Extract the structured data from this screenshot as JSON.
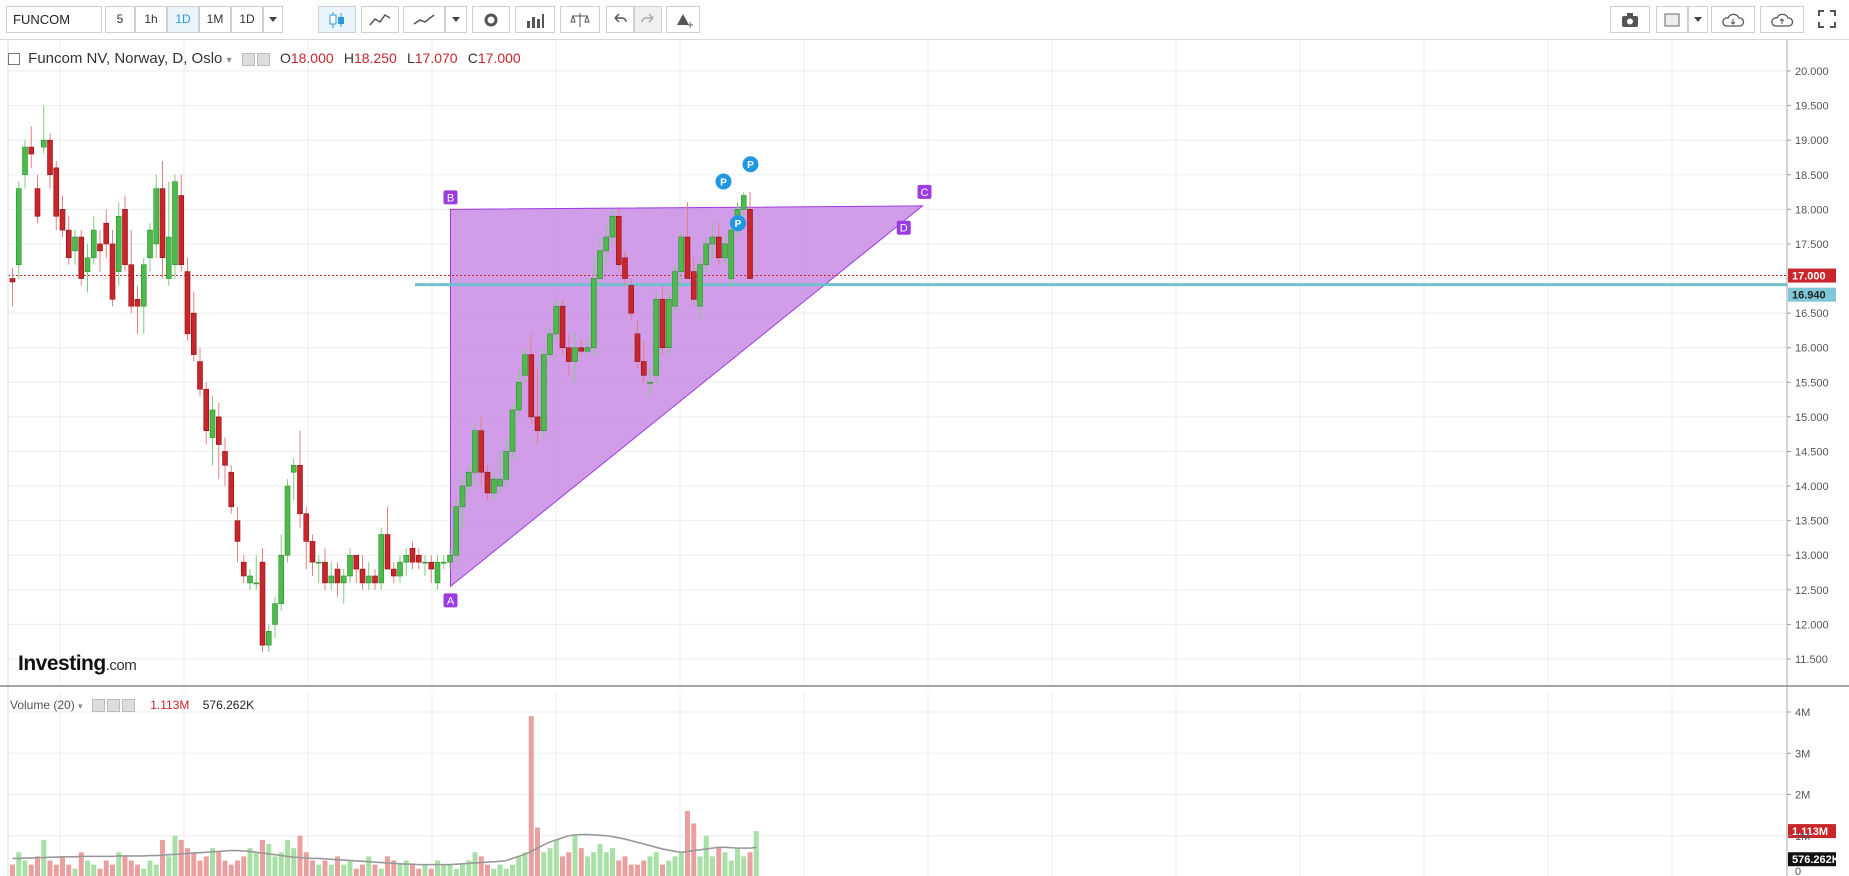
{
  "toolbar": {
    "symbol": "FUNCOM",
    "intervals": [
      "5",
      "1h",
      "1D",
      "1M",
      "1D"
    ],
    "active_interval": "1D"
  },
  "legend": {
    "title": "Funcom NV, Norway, D, Oslo",
    "o_label": "O",
    "o_value": "18.000",
    "h_label": "H",
    "h_value": "18.250",
    "l_label": "L",
    "l_value": "17.070",
    "c_label": "C",
    "c_value": "17.000"
  },
  "volume_legend": {
    "title": "Volume (20)",
    "value": "1.113M",
    "ma_value": "576.262K"
  },
  "watermark": {
    "brand": "Investing",
    "suffix": ".com"
  },
  "colors": {
    "up": "#4cbb4c",
    "down": "#c8262a",
    "pattern": "#9b3ce0",
    "pattern_fill": "#c98be4",
    "hline": "#6fbfd0"
  },
  "chart_data": [
    {
      "type": "candlestick",
      "title": "Funcom NV, Norway, D, Oslo",
      "y_ticks": [
        "11.500",
        "12.000",
        "12.500",
        "13.000",
        "13.500",
        "14.000",
        "14.500",
        "15.000",
        "15.500",
        "16.000",
        "16.500",
        "17.000",
        "17.500",
        "18.000",
        "18.500",
        "19.000",
        "19.500",
        "20.000"
      ],
      "ylim": [
        11.2,
        20.3
      ],
      "grid": true,
      "ohlc": [
        [
          17.0,
          17.15,
          16.6,
          16.95
        ],
        [
          17.2,
          18.4,
          17.0,
          18.3
        ],
        [
          18.5,
          19.0,
          18.3,
          18.9
        ],
        [
          18.9,
          19.2,
          18.6,
          18.8
        ],
        [
          18.3,
          18.5,
          17.8,
          17.9
        ],
        [
          18.9,
          19.5,
          18.8,
          19.0
        ],
        [
          19.0,
          19.1,
          18.3,
          18.5
        ],
        [
          18.6,
          18.7,
          17.7,
          17.9
        ],
        [
          18.0,
          18.2,
          17.6,
          17.7
        ],
        [
          17.7,
          17.9,
          17.2,
          17.3
        ],
        [
          17.4,
          17.7,
          17.2,
          17.6
        ],
        [
          17.6,
          17.7,
          16.9,
          17.0
        ],
        [
          17.1,
          17.5,
          16.8,
          17.3
        ],
        [
          17.3,
          17.9,
          17.2,
          17.7
        ],
        [
          17.5,
          17.7,
          17.1,
          17.4
        ],
        [
          17.8,
          18.0,
          17.3,
          17.5
        ],
        [
          17.5,
          17.7,
          16.6,
          16.7
        ],
        [
          17.1,
          18.1,
          16.9,
          17.9
        ],
        [
          18.0,
          18.2,
          17.1,
          17.2
        ],
        [
          17.2,
          17.7,
          16.5,
          16.6
        ],
        [
          16.7,
          16.9,
          16.2,
          16.6
        ],
        [
          16.6,
          17.3,
          16.2,
          17.2
        ],
        [
          17.3,
          17.8,
          17.1,
          17.7
        ],
        [
          17.5,
          18.5,
          17.3,
          18.3
        ],
        [
          18.3,
          18.7,
          17.0,
          17.3
        ],
        [
          17.0,
          18.4,
          16.9,
          17.6
        ],
        [
          17.2,
          18.5,
          17.0,
          18.4
        ],
        [
          18.2,
          18.5,
          17.1,
          17.2
        ],
        [
          17.1,
          17.3,
          16.1,
          16.2
        ],
        [
          16.5,
          16.8,
          15.8,
          15.9
        ],
        [
          15.8,
          16.0,
          15.3,
          15.4
        ],
        [
          15.4,
          15.5,
          14.6,
          14.8
        ],
        [
          14.7,
          15.3,
          14.3,
          15.1
        ],
        [
          15.0,
          15.2,
          14.1,
          14.6
        ],
        [
          14.5,
          14.7,
          14.0,
          14.3
        ],
        [
          14.2,
          14.3,
          13.6,
          13.7
        ],
        [
          13.5,
          13.7,
          12.9,
          13.2
        ],
        [
          12.9,
          13.0,
          12.6,
          12.7
        ],
        [
          12.6,
          12.8,
          12.5,
          12.7
        ],
        [
          12.6,
          13.0,
          12.5,
          12.6
        ],
        [
          12.9,
          13.1,
          11.6,
          11.7
        ],
        [
          11.7,
          12.0,
          11.6,
          11.9
        ],
        [
          12.0,
          12.4,
          11.8,
          12.3
        ],
        [
          12.3,
          13.3,
          12.2,
          13.0
        ],
        [
          13.0,
          14.1,
          12.9,
          14.0
        ],
        [
          14.2,
          14.4,
          13.8,
          14.3
        ],
        [
          14.3,
          14.8,
          13.4,
          13.6
        ],
        [
          13.6,
          13.7,
          12.8,
          13.2
        ],
        [
          13.2,
          13.3,
          12.7,
          12.9
        ],
        [
          12.9,
          13.0,
          12.6,
          12.9
        ],
        [
          12.9,
          13.1,
          12.5,
          12.6
        ],
        [
          12.6,
          12.9,
          12.5,
          12.7
        ],
        [
          12.8,
          12.9,
          12.4,
          12.6
        ],
        [
          12.6,
          12.8,
          12.3,
          12.7
        ],
        [
          12.7,
          13.1,
          12.6,
          13.0
        ],
        [
          13.0,
          13.0,
          12.6,
          12.8
        ],
        [
          12.8,
          13.0,
          12.5,
          12.6
        ],
        [
          12.6,
          12.9,
          12.5,
          12.7
        ],
        [
          12.7,
          12.8,
          12.5,
          12.6
        ],
        [
          12.6,
          13.4,
          12.5,
          13.3
        ],
        [
          13.3,
          13.7,
          12.8,
          12.8
        ],
        [
          12.8,
          12.9,
          12.6,
          12.7
        ],
        [
          12.7,
          13.0,
          12.6,
          12.9
        ],
        [
          12.9,
          13.1,
          12.7,
          13.0
        ],
        [
          13.1,
          13.2,
          12.8,
          12.9
        ],
        [
          13.0,
          13.1,
          12.8,
          12.9
        ],
        [
          12.9,
          13.0,
          12.7,
          12.9
        ],
        [
          12.9,
          13.0,
          12.6,
          12.8
        ],
        [
          12.6,
          13.0,
          12.5,
          12.9
        ],
        [
          12.9,
          13.0,
          12.8,
          12.9
        ],
        [
          12.9,
          13.1,
          12.8,
          13.0
        ],
        [
          13.0,
          13.8,
          12.9,
          13.7
        ],
        [
          13.7,
          14.1,
          13.4,
          14.0
        ],
        [
          14.0,
          14.3,
          13.9,
          14.2
        ],
        [
          14.2,
          14.9,
          14.0,
          14.8
        ],
        [
          14.8,
          15.0,
          14.0,
          14.2
        ],
        [
          14.2,
          14.3,
          13.8,
          13.9
        ],
        [
          13.9,
          14.2,
          13.8,
          14.1
        ],
        [
          14.0,
          14.5,
          13.9,
          14.1
        ],
        [
          14.1,
          14.7,
          14.0,
          14.5
        ],
        [
          14.5,
          15.2,
          14.4,
          15.1
        ],
        [
          15.1,
          15.7,
          15.0,
          15.5
        ],
        [
          15.6,
          16.0,
          15.5,
          15.9
        ],
        [
          15.9,
          16.2,
          14.9,
          15.0
        ],
        [
          15.0,
          15.7,
          14.6,
          14.8
        ],
        [
          14.8,
          16.0,
          14.7,
          15.9
        ],
        [
          15.9,
          16.3,
          15.8,
          16.2
        ],
        [
          16.2,
          16.7,
          16.1,
          16.6
        ],
        [
          16.6,
          16.7,
          15.9,
          16.0
        ],
        [
          16.0,
          16.2,
          15.6,
          15.8
        ],
        [
          15.8,
          16.2,
          15.5,
          16.0
        ],
        [
          16.0,
          16.1,
          15.9,
          15.95
        ],
        [
          15.95,
          16.1,
          15.9,
          16.0
        ],
        [
          16.0,
          17.3,
          15.9,
          17.0
        ],
        [
          17.0,
          17.6,
          16.9,
          17.4
        ],
        [
          17.4,
          17.8,
          17.2,
          17.6
        ],
        [
          17.6,
          18.0,
          17.5,
          17.9
        ],
        [
          17.9,
          18.0,
          17.1,
          17.2
        ],
        [
          17.3,
          17.4,
          16.9,
          17.0
        ],
        [
          16.9,
          17.0,
          16.4,
          16.5
        ],
        [
          16.2,
          16.4,
          15.7,
          15.8
        ],
        [
          15.8,
          16.1,
          15.5,
          15.6
        ],
        [
          15.5,
          15.7,
          15.3,
          15.5
        ],
        [
          15.6,
          16.8,
          15.5,
          16.7
        ],
        [
          16.7,
          16.9,
          15.9,
          16.0
        ],
        [
          16.0,
          16.8,
          15.9,
          16.7
        ],
        [
          16.6,
          17.2,
          16.5,
          17.1
        ],
        [
          17.1,
          17.7,
          16.9,
          17.6
        ],
        [
          17.6,
          18.1,
          17.5,
          17.0
        ],
        [
          17.1,
          17.3,
          16.6,
          16.7
        ],
        [
          16.6,
          17.3,
          16.4,
          17.2
        ],
        [
          17.2,
          17.6,
          17.1,
          17.5
        ],
        [
          17.5,
          17.8,
          17.3,
          17.6
        ],
        [
          17.6,
          17.8,
          17.2,
          17.3
        ],
        [
          17.3,
          17.6,
          17.2,
          17.5
        ],
        [
          17.0,
          17.8,
          16.9,
          17.7
        ],
        [
          17.7,
          18.1,
          17.6,
          18.0
        ],
        [
          18.0,
          18.25,
          17.8,
          18.2
        ],
        [
          18.0,
          18.25,
          17.07,
          17.0
        ]
      ],
      "last_price": "17.000",
      "level_price": "16.940",
      "pattern": {
        "type": "triangle",
        "points": [
          {
            "label": "A",
            "bar": 70,
            "price": 12.55
          },
          {
            "label": "B",
            "bar": 70,
            "price": 18.0
          },
          {
            "label": "C",
            "bar": 138,
            "price": 18.05
          },
          {
            "label": "D",
            "bar": 135,
            "price": 17.85
          }
        ]
      },
      "pivots": [
        {
          "label": "P",
          "bar": 114,
          "price": 18.2
        },
        {
          "label": "P",
          "bar": 118,
          "price": 18.45
        },
        {
          "label": "P",
          "bar": 116,
          "price": 17.8
        }
      ]
    },
    {
      "type": "bar",
      "title": "Volume (20)",
      "y_ticks": [
        "0",
        "1M",
        "2M",
        "3M",
        "4M"
      ],
      "ylim": [
        0,
        4.1
      ],
      "last_value": "1.113M",
      "ma_value": "576.262K",
      "volumes": [
        0.3,
        0.6,
        0.4,
        0.3,
        0.5,
        0.9,
        0.4,
        0.3,
        0.5,
        0.3,
        0.2,
        0.6,
        0.4,
        0.3,
        0.2,
        0.4,
        0.3,
        0.6,
        0.5,
        0.4,
        0.3,
        0.2,
        0.4,
        0.3,
        0.9,
        0.5,
        1.0,
        0.9,
        0.7,
        0.6,
        0.4,
        0.5,
        0.7,
        0.6,
        0.4,
        0.3,
        0.4,
        0.5,
        0.7,
        0.6,
        0.9,
        0.8,
        0.5,
        0.6,
        0.9,
        0.7,
        1.0,
        0.6,
        0.4,
        0.3,
        0.4,
        0.3,
        0.5,
        0.3,
        0.4,
        0.2,
        0.3,
        0.5,
        0.3,
        0.2,
        0.5,
        0.4,
        0.3,
        0.4,
        0.3,
        0.2,
        0.3,
        0.2,
        0.4,
        0.3,
        0.3,
        0.2,
        0.3,
        0.4,
        0.6,
        0.5,
        0.3,
        0.2,
        0.3,
        0.2,
        0.3,
        0.5,
        0.6,
        3.9,
        1.2,
        0.6,
        0.7,
        0.9,
        0.5,
        0.6,
        1.0,
        0.7,
        0.5,
        0.6,
        0.8,
        0.6,
        0.7,
        0.4,
        0.5,
        0.3,
        0.3,
        0.4,
        0.5,
        0.6,
        0.3,
        0.4,
        0.5,
        0.6,
        1.6,
        1.3,
        0.5,
        1.0,
        0.5,
        0.7,
        0.6,
        0.4,
        0.7,
        0.5,
        0.6,
        1.113
      ],
      "ma": [
        0.45,
        0.45,
        0.46,
        0.46,
        0.47,
        0.47,
        0.48,
        0.48,
        0.49,
        0.49,
        0.49,
        0.5,
        0.5,
        0.5,
        0.5,
        0.5,
        0.5,
        0.51,
        0.51,
        0.51,
        0.51,
        0.51,
        0.52,
        0.52,
        0.53,
        0.54,
        0.55,
        0.56,
        0.57,
        0.58,
        0.59,
        0.6,
        0.61,
        0.62,
        0.63,
        0.64,
        0.64,
        0.63,
        0.62,
        0.6,
        0.58,
        0.56,
        0.54,
        0.52,
        0.5,
        0.48,
        0.47,
        0.46,
        0.45,
        0.45,
        0.44,
        0.43,
        0.42,
        0.41,
        0.4,
        0.39,
        0.38,
        0.37,
        0.36,
        0.35,
        0.34,
        0.33,
        0.32,
        0.31,
        0.31,
        0.3,
        0.3,
        0.3,
        0.3,
        0.3,
        0.3,
        0.31,
        0.32,
        0.33,
        0.34,
        0.35,
        0.36,
        0.37,
        0.38,
        0.4,
        0.45,
        0.5,
        0.55,
        0.62,
        0.7,
        0.78,
        0.85,
        0.9,
        0.95,
        1.0,
        1.02,
        1.03,
        1.03,
        1.02,
        1.01,
        1.0,
        0.98,
        0.95,
        0.92,
        0.88,
        0.84,
        0.8,
        0.76,
        0.72,
        0.68,
        0.65,
        0.62,
        0.6,
        0.62,
        0.64,
        0.66,
        0.68,
        0.7,
        0.72,
        0.72,
        0.71,
        0.7,
        0.7,
        0.7,
        0.72
      ]
    }
  ]
}
